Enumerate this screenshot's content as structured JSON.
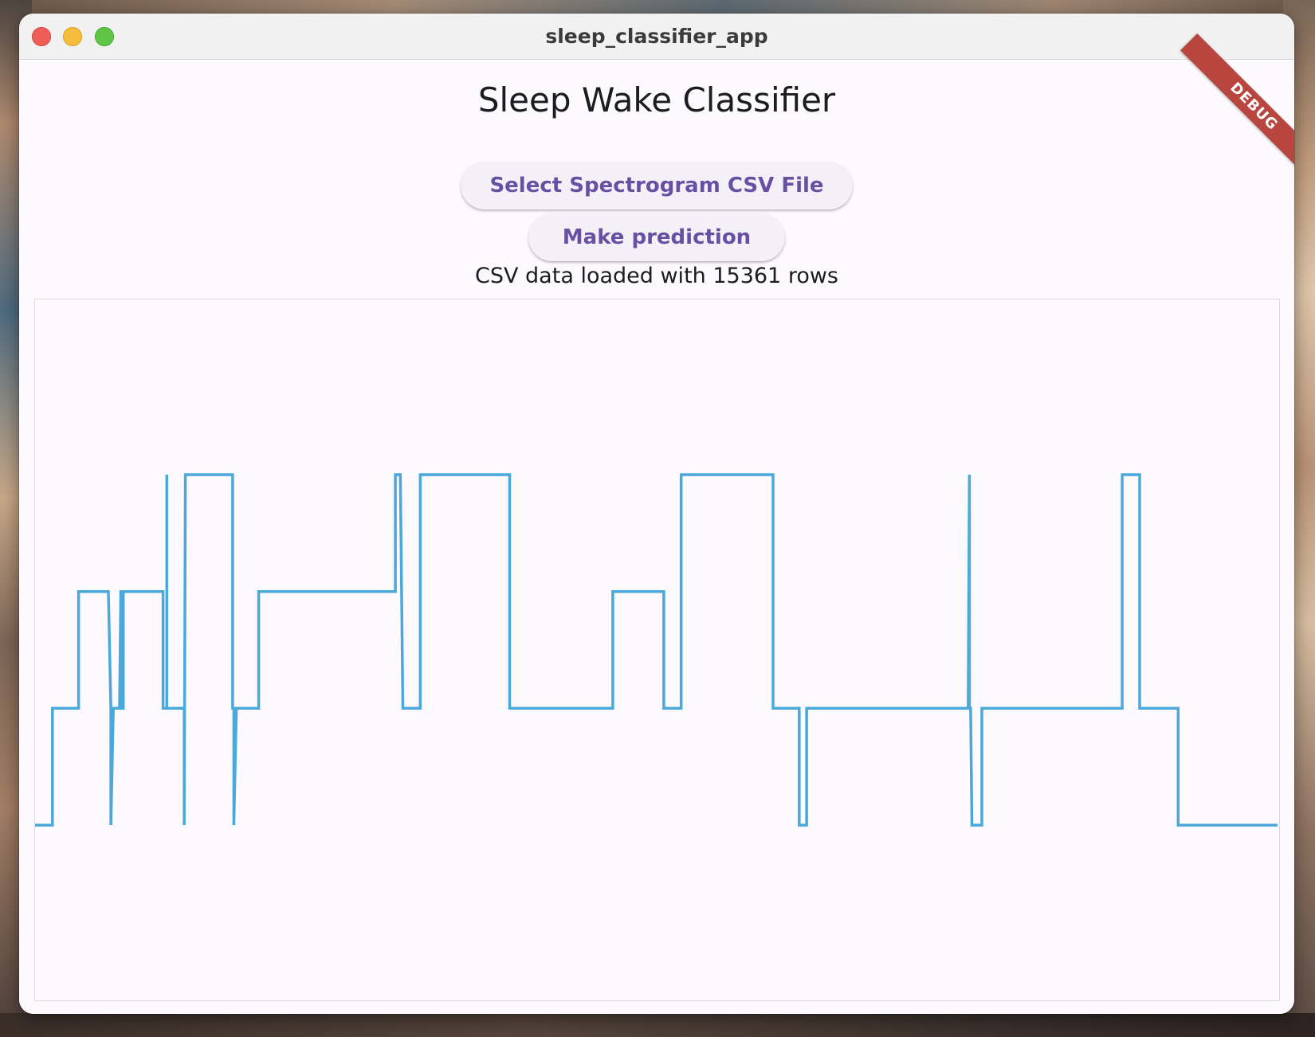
{
  "window": {
    "title": "sleep_classifier_app",
    "debug_banner": "DEBUG"
  },
  "app": {
    "heading": "Sleep Wake Classifier",
    "select_button_label": "Select Spectrogram CSV File",
    "predict_button_label": "Make prediction",
    "status_text": "CSV data loaded with 15361 rows"
  },
  "colors": {
    "line": "#4aa8da",
    "button_text": "#6750a4",
    "debug_ribbon": "#b9453f"
  },
  "chart_data": {
    "type": "line",
    "interpolation": "step",
    "x_range": [
      0,
      100
    ],
    "ylim": [
      -1.5,
      4.5
    ],
    "grid": false,
    "points": [
      [
        0.0,
        0
      ],
      [
        1.4,
        0
      ],
      [
        1.4,
        1
      ],
      [
        3.5,
        1
      ],
      [
        3.5,
        2
      ],
      [
        5.9,
        2
      ],
      [
        6.1,
        1
      ],
      [
        6.1,
        0
      ],
      [
        6.3,
        1
      ],
      [
        6.8,
        1
      ],
      [
        6.9,
        2
      ],
      [
        7.0,
        2
      ],
      [
        7.0,
        1
      ],
      [
        7.1,
        1
      ],
      [
        7.1,
        2
      ],
      [
        10.3,
        2
      ],
      [
        10.3,
        1
      ],
      [
        10.6,
        1
      ],
      [
        10.6,
        3
      ],
      [
        10.6,
        1
      ],
      [
        12.0,
        1
      ],
      [
        12.0,
        0
      ],
      [
        12.1,
        3
      ],
      [
        15.9,
        3
      ],
      [
        15.9,
        1
      ],
      [
        16.0,
        1
      ],
      [
        16.0,
        0
      ],
      [
        16.2,
        1
      ],
      [
        18.0,
        1
      ],
      [
        18.0,
        2
      ],
      [
        29.0,
        2
      ],
      [
        29.0,
        3
      ],
      [
        29.4,
        3
      ],
      [
        29.6,
        1
      ],
      [
        31.0,
        1
      ],
      [
        31.0,
        3
      ],
      [
        38.2,
        3
      ],
      [
        38.2,
        1
      ],
      [
        46.5,
        1
      ],
      [
        46.5,
        2
      ],
      [
        50.6,
        2
      ],
      [
        50.6,
        1
      ],
      [
        52.0,
        1
      ],
      [
        52.0,
        3
      ],
      [
        59.4,
        3
      ],
      [
        59.4,
        1
      ],
      [
        61.5,
        1
      ],
      [
        61.5,
        0
      ],
      [
        62.1,
        0
      ],
      [
        62.1,
        1
      ],
      [
        75.1,
        1
      ],
      [
        75.2,
        3
      ],
      [
        75.2,
        1
      ],
      [
        75.3,
        1
      ],
      [
        75.4,
        0
      ],
      [
        76.2,
        0
      ],
      [
        76.2,
        1
      ],
      [
        87.5,
        1
      ],
      [
        87.5,
        3
      ],
      [
        88.9,
        3
      ],
      [
        88.9,
        1
      ],
      [
        92.0,
        1
      ],
      [
        92.0,
        0
      ],
      [
        100.0,
        0
      ]
    ]
  }
}
